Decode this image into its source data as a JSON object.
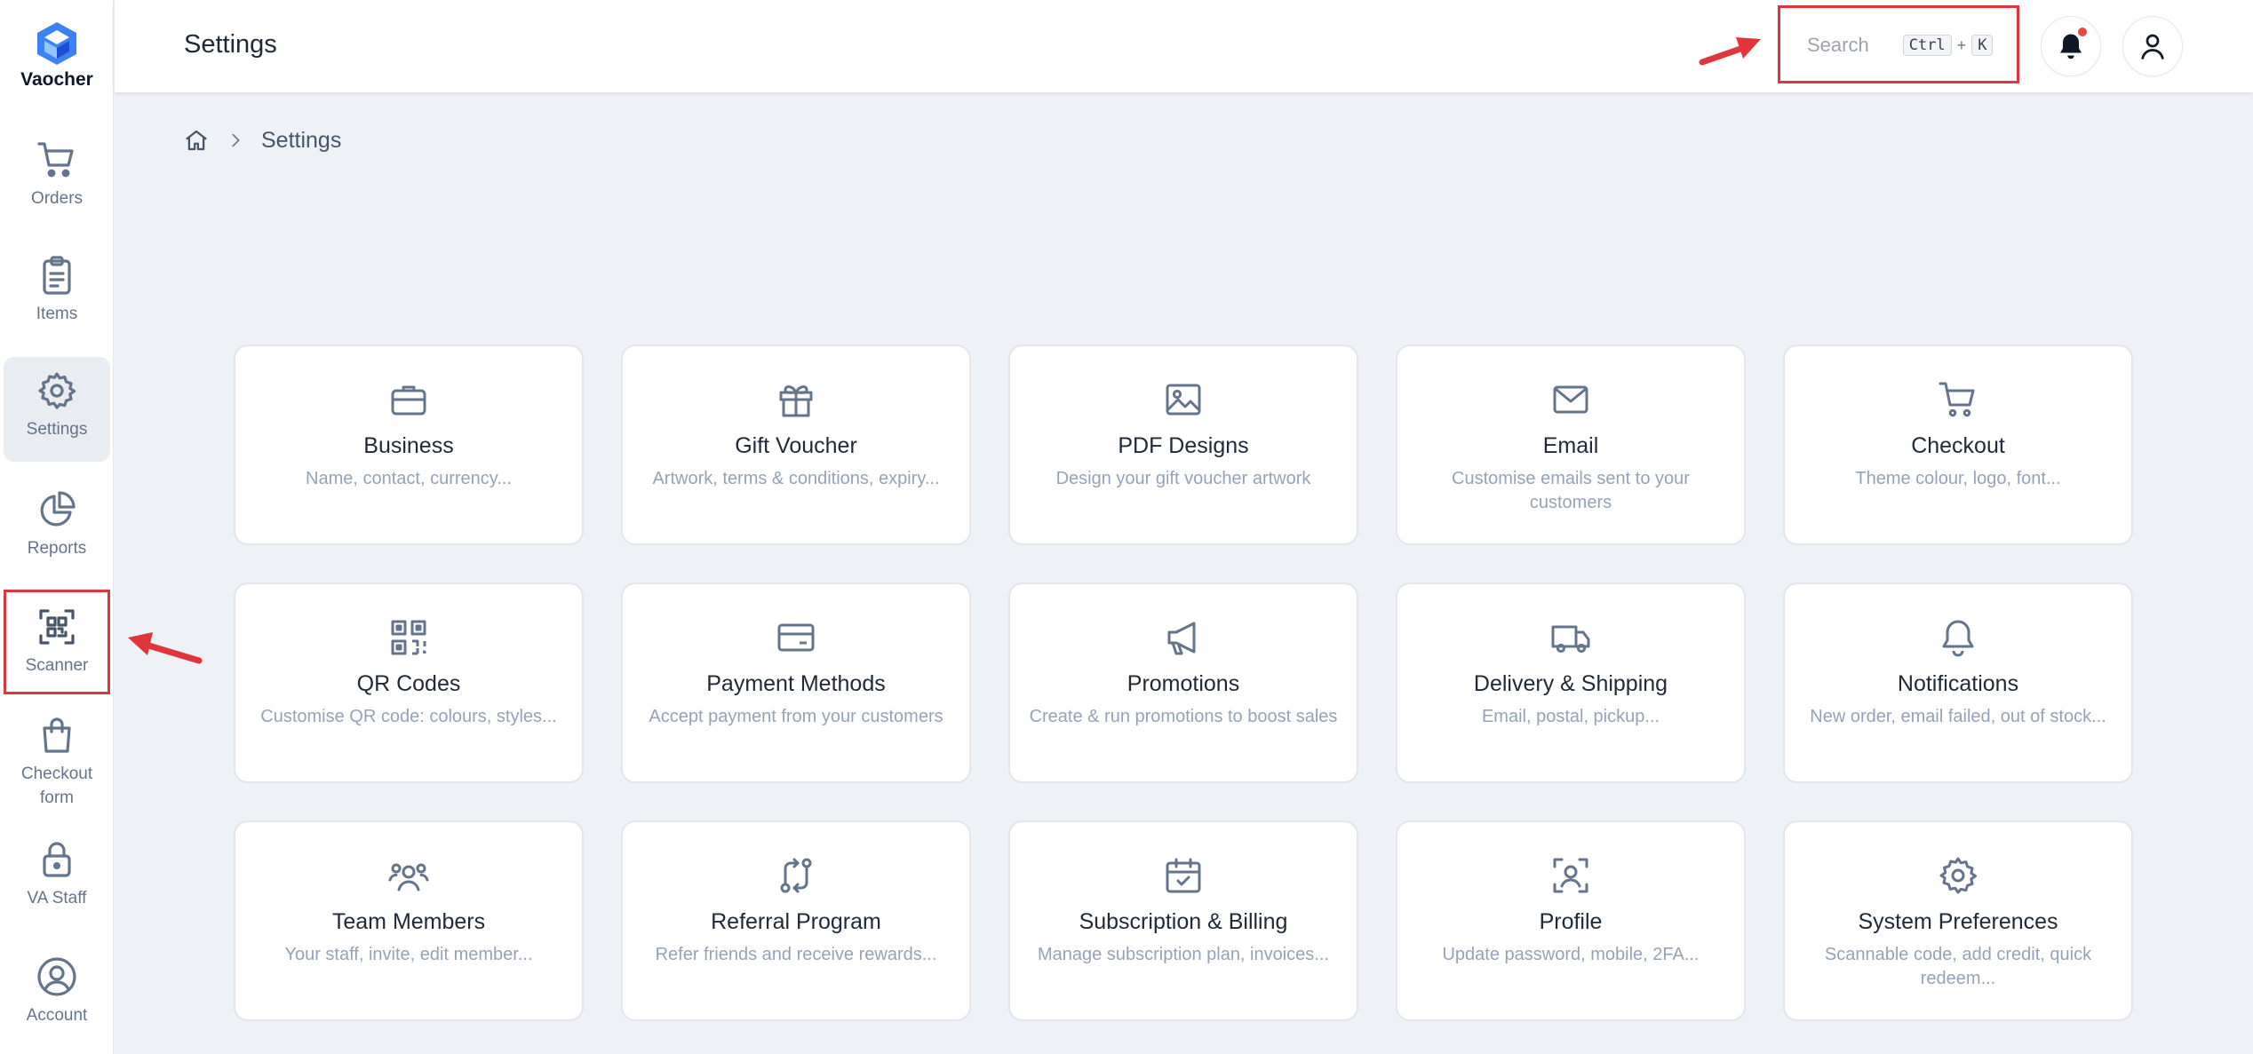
{
  "app": {
    "name": "Vaocher",
    "page_title": "Settings"
  },
  "sidebar": {
    "items": [
      {
        "label": "Orders",
        "icon": "cart-icon"
      },
      {
        "label": "Items",
        "icon": "clipboard-icon"
      },
      {
        "label": "Settings",
        "icon": "gear-icon"
      },
      {
        "label": "Reports",
        "icon": "pie-chart-icon"
      },
      {
        "label": "Scanner",
        "icon": "qr-scan-icon"
      },
      {
        "label": "Checkout form",
        "icon": "shopping-bag-icon"
      },
      {
        "label": "VA Staff",
        "icon": "lock-icon"
      },
      {
        "label": "Account",
        "icon": "user-circle-icon"
      }
    ],
    "active_label": "Settings"
  },
  "header": {
    "search": {
      "placeholder": "Search",
      "shortcut_key_1": "Ctrl",
      "shortcut_plus": "+",
      "shortcut_key_2": "K"
    }
  },
  "breadcrumb": {
    "current": "Settings"
  },
  "cards": [
    {
      "title": "Business",
      "desc": "Name, contact, currency...",
      "icon": "briefcase-icon"
    },
    {
      "title": "Gift Voucher",
      "desc": "Artwork, terms & conditions, expiry...",
      "icon": "gift-icon"
    },
    {
      "title": "PDF Designs",
      "desc": "Design your gift voucher artwork",
      "icon": "image-icon"
    },
    {
      "title": "Email",
      "desc": "Customise emails sent to your customers",
      "icon": "envelope-icon"
    },
    {
      "title": "Checkout",
      "desc": "Theme colour, logo, font...",
      "icon": "cart-icon"
    },
    {
      "title": "QR Codes",
      "desc": "Customise QR code: colours, styles...",
      "icon": "qr-code-icon"
    },
    {
      "title": "Payment Methods",
      "desc": "Accept payment from your customers",
      "icon": "credit-card-icon"
    },
    {
      "title": "Promotions",
      "desc": "Create & run promotions to boost sales",
      "icon": "megaphone-icon"
    },
    {
      "title": "Delivery & Shipping",
      "desc": "Email, postal, pickup...",
      "icon": "truck-icon"
    },
    {
      "title": "Notifications",
      "desc": "New order, email failed, out of stock...",
      "icon": "bell-icon"
    },
    {
      "title": "Team Members",
      "desc": "Your staff, invite, edit member...",
      "icon": "users-icon"
    },
    {
      "title": "Referral Program",
      "desc": "Refer friends and receive rewards...",
      "icon": "arrows-exchange-icon"
    },
    {
      "title": "Subscription & Billing",
      "desc": "Manage subscription plan, invoices...",
      "icon": "calendar-check-icon"
    },
    {
      "title": "Profile",
      "desc": "Update password, mobile, 2FA...",
      "icon": "user-scan-icon"
    },
    {
      "title": "System Preferences",
      "desc": "Scannable code, add credit, quick redeem...",
      "icon": "gear-icon"
    }
  ],
  "colors": {
    "highlight_red": "#e0353a",
    "icon_slate": "#64748b",
    "notification_dot": "#ef4444",
    "logo_blue": "#3b82f6"
  }
}
